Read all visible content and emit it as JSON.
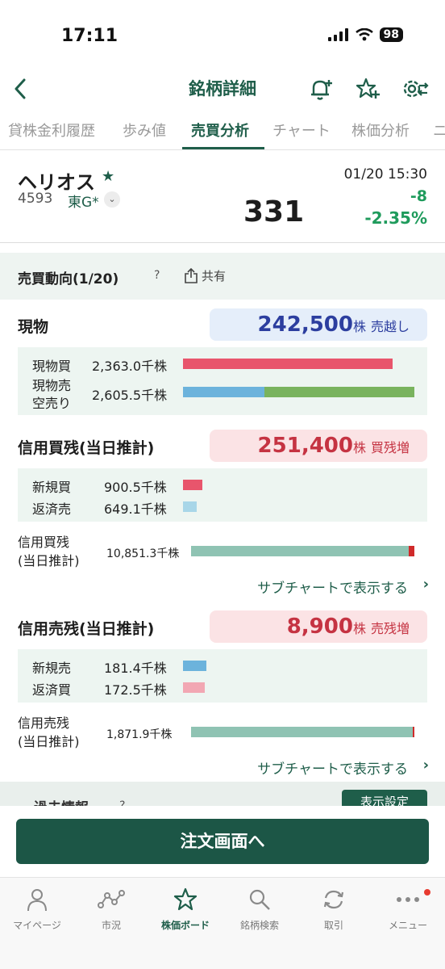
{
  "status_bar": {
    "time": "17:11",
    "battery": "98"
  },
  "header": {
    "title": "銘柄詳細"
  },
  "tabs": [
    {
      "label": "貸株金利履歴"
    },
    {
      "label": "歩み値"
    },
    {
      "label": "売買分析"
    },
    {
      "label": "チャート"
    },
    {
      "label": "株価分析"
    },
    {
      "label": "ニ"
    }
  ],
  "stock": {
    "name": "ヘリオス",
    "code": "4593",
    "market": "東G*",
    "datetime": "01/20 15:30",
    "price": "331",
    "change": "-8",
    "change_pct": "-2.35%"
  },
  "section": {
    "title": "売買動向(1/20)",
    "help": "?",
    "share_label": "共有"
  },
  "cash": {
    "title": "現物",
    "value": "242,500",
    "unit": "株",
    "status": "売越し",
    "buy": {
      "label": "現物買",
      "value": "2,363.0千株"
    },
    "sell": {
      "label1": "現物売",
      "label2": "空売り",
      "value": "2,605.5千株"
    }
  },
  "margin_buy": {
    "title": "信用買残(当日推計)",
    "value": "251,400",
    "unit": "株",
    "status": "買残増",
    "new": {
      "label": "新規買",
      "value": "900.5千株"
    },
    "repay": {
      "label": "返済売",
      "value": "649.1千株"
    },
    "balance": {
      "label1": "信用買残",
      "label2": "(当日推計)",
      "value": "10,851.3千株"
    },
    "subchart_link": "サブチャートで表示する"
  },
  "margin_sell": {
    "title": "信用売残(当日推計)",
    "value": "8,900",
    "unit": "株",
    "status": "売残増",
    "new": {
      "label": "新規売",
      "value": "181.4千株"
    },
    "repay": {
      "label": "返済買",
      "value": "172.5千株"
    },
    "balance": {
      "label1": "信用売残",
      "label2": "(当日推計)",
      "value": "1,871.9千株"
    },
    "subchart_link": "サブチャートで表示する"
  },
  "past": {
    "title": "過去情報",
    "help": "?",
    "display_settings": "表示設定"
  },
  "order_button": "注文画面へ",
  "tabbar": [
    {
      "label": "マイページ",
      "icon": "person-icon"
    },
    {
      "label": "市況",
      "icon": "market-icon"
    },
    {
      "label": "株価ボード",
      "icon": "star-icon"
    },
    {
      "label": "銘柄検索",
      "icon": "search-icon"
    },
    {
      "label": "取引",
      "icon": "trade-icon"
    },
    {
      "label": "メニュー",
      "icon": "menu-icon"
    }
  ],
  "colors": {
    "brand": "#1f5e4a",
    "buy_red": "#e8556c",
    "sell_blue": "#6cb3dc",
    "short_green": "#79b35e",
    "balance_teal": "#8fc3b3",
    "up_green": "#1f9b5c"
  }
}
